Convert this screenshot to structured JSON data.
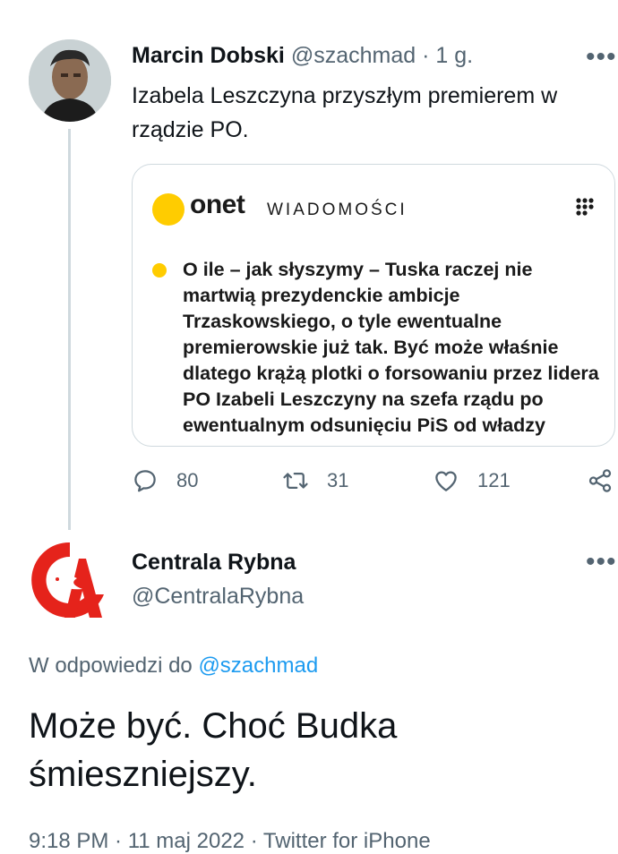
{
  "parent_tweet": {
    "display_name": "Marcin Dobski",
    "handle": "@szachmad",
    "time": "· 1 g.",
    "more": "•••",
    "text": "Izabela Leszczyna przyszłym premierem w rządzie PO.",
    "card": {
      "brand": "onet",
      "section": "WIADOMOŚCI",
      "quote": "O ile – jak słyszymy – Tuska raczej nie martwią prezydenckie ambicje Trzaskowskiego, o tyle ewentualne premierowskie już tak. Być może właśnie dlatego krążą plotki o forsowaniu przez lidera PO Izabeli Leszczyny na szefa rządu po ewentualnym odsunięciu PiS od władzy",
      "brand_color": "#ffcc00"
    },
    "actions": {
      "replies": "80",
      "retweets": "31",
      "likes": "121"
    }
  },
  "reply_tweet": {
    "display_name": "Centrala Rybna",
    "handle": "@CentralaRybna",
    "more": "•••",
    "replying_prefix": "W odpowiedzi do",
    "replying_to": "@szachmad",
    "text": "Może być. Choć Budka śmieszniejszy.",
    "meta": "9:18 PM · 11 maj 2022 · Twitter for iPhone",
    "logo_color": "#e5231b"
  },
  "colors": {
    "text": "#0f1419",
    "secondary": "#536471",
    "link": "#1d9bf0",
    "border": "#cfd9de"
  }
}
